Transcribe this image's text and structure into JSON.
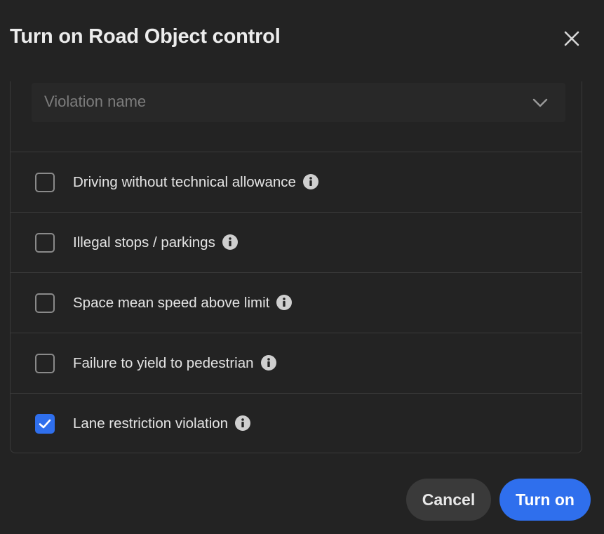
{
  "dialog": {
    "title": "Turn on Road Object control",
    "close_icon": "close-icon"
  },
  "select": {
    "placeholder": "Violation name",
    "icon": "chevron-down-icon"
  },
  "violations": [
    {
      "label": "Driving without technical allowance",
      "checked": false
    },
    {
      "label": "Illegal stops / parkings",
      "checked": false
    },
    {
      "label": "Space mean speed above limit",
      "checked": false
    },
    {
      "label": "Failure to yield to pedestrian",
      "checked": false
    },
    {
      "label": "Lane restriction violation",
      "checked": true
    }
  ],
  "buttons": {
    "cancel": "Cancel",
    "turn_on": "Turn on"
  },
  "colors": {
    "background": "#232323",
    "accent": "#2f6fed",
    "divider": "#3a3a3a"
  }
}
